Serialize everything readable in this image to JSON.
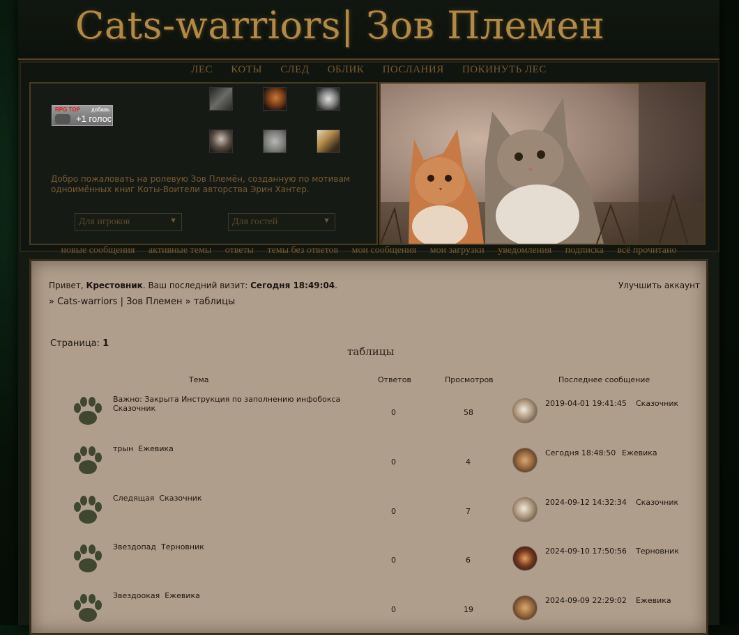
{
  "site": {
    "logo": "Cats-warriors| Зов Племен"
  },
  "nav": [
    "ЛЕС",
    "КОТЫ",
    "СЛЕД",
    "ОБЛИК",
    "ПОСЛАНИЯ",
    "ПОКИНУТЬ ЛЕС"
  ],
  "rpgtop": {
    "brand": "RPG TOP",
    "add": "добавь",
    "vote": "+1 голос"
  },
  "welcome": "Добро пожаловать на ролевую Зов Племён, созданную по мотивам одноимённых книг Коты-Воители авторства Эрин Хантер.",
  "selects": {
    "players": "Для игроков",
    "guests": "Для гостей"
  },
  "sublinks": [
    "новые сообщения",
    "активные темы",
    "ответы",
    "темы без ответов",
    "мои сообщения",
    "мои загрузки",
    "уведомления",
    "подписка",
    "всё прочитано"
  ],
  "greeting": {
    "hello": "Привет, ",
    "user": "Крестовник",
    "visit_text": ". Ваш последний визит: ",
    "visit_time": "Сегодня 18:49:04",
    "end": ".",
    "upgrade": "Улучшить аккаунт"
  },
  "breadcrumb": {
    "sep1": "» ",
    "forum": "Cats-warriors | Зов Племен",
    "sep2": " » ",
    "section": "таблицы"
  },
  "pager": {
    "label": "Страница: ",
    "page": "1"
  },
  "section_title": "таблицы",
  "columns": {
    "topic": "Тема",
    "replies": "Ответов",
    "views": "Просмотров",
    "last": "Последнее сообщение"
  },
  "topics": [
    {
      "title": "Важно: Закрыта Инструкция по заполнению инфобокса",
      "author": " Сказочник",
      "replies": "0",
      "views": "58",
      "last_date": "2019-04-01 19:41:45",
      "last_author": "Сказочник"
    },
    {
      "title": "трын",
      "author": "Ежевика",
      "replies": "0",
      "views": "4",
      "last_date": "Сегодня 18:48:50",
      "last_author": "Ежевика"
    },
    {
      "title": "Следящая",
      "author": "Сказочник",
      "replies": "0",
      "views": "7",
      "last_date": "2024-09-12 14:32:34",
      "last_author": "Сказочник"
    },
    {
      "title": "Звездопад",
      "author": "Терновник",
      "replies": "0",
      "views": "6",
      "last_date": "2024-09-10 17:50:56",
      "last_author": "Терновник"
    },
    {
      "title": "Звездоокая",
      "author": "Ежевика",
      "replies": "0",
      "views": "19",
      "last_date": "2024-09-09 22:29:02",
      "last_author": "Ежевика"
    }
  ],
  "colors": {
    "gold": "#b08a47",
    "brown_link": "#7a5a30",
    "paper": "#b09e8c",
    "paw": "#3f4730"
  }
}
